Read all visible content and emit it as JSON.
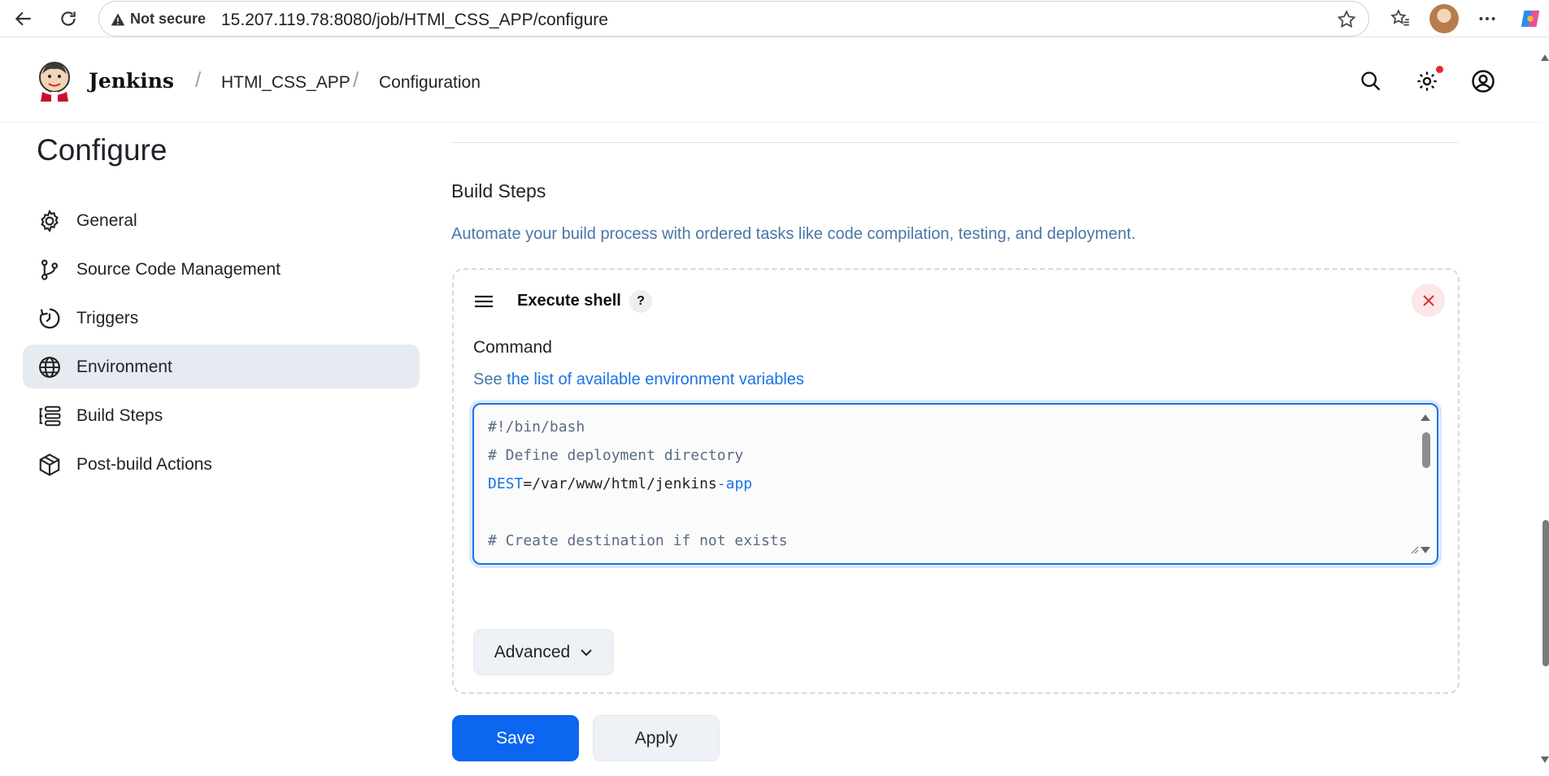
{
  "browser": {
    "security_label": "Not secure",
    "url": "15.207.119.78:8080/job/HTMl_CSS_APP/configure"
  },
  "header": {
    "brand": "Jenkins",
    "breadcrumbs": [
      "HTMl_CSS_APP",
      "Configuration"
    ]
  },
  "sidebar": {
    "title": "Configure",
    "items": [
      {
        "label": "General",
        "icon": "gear-icon"
      },
      {
        "label": "Source Code Management",
        "icon": "git-branch-icon"
      },
      {
        "label": "Triggers",
        "icon": "timer-icon"
      },
      {
        "label": "Environment",
        "icon": "globe-icon",
        "active": true
      },
      {
        "label": "Build Steps",
        "icon": "list-icon"
      },
      {
        "label": "Post-build Actions",
        "icon": "package-icon"
      }
    ]
  },
  "main": {
    "section_title": "Build Steps",
    "section_description": "Automate your build process with ordered tasks like code compilation, testing, and deployment.",
    "step": {
      "title": "Execute shell",
      "help": "?",
      "command_label": "Command",
      "see_prefix": "See",
      "see_link": "the list of available environment variables",
      "code": {
        "line1": "#!/bin/bash",
        "line2": "# Define deployment directory",
        "line3_var": "DEST",
        "line3_mid": "=/var/www/html/jenkins",
        "line3_dash": "-",
        "line3_end": "app",
        "line5": "# Create destination if not exists"
      },
      "advanced_label": "Advanced"
    },
    "save_label": "Save",
    "apply_label": "Apply"
  },
  "colors": {
    "primary": "#0b66f0",
    "active_nav": "#e6ebf1",
    "link": "#1a73e8"
  }
}
